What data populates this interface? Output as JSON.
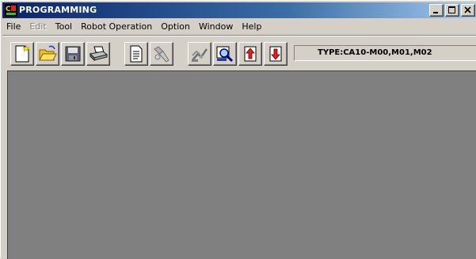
{
  "window": {
    "title": "PROGRAMMING",
    "controls": [
      "minimize",
      "maximize",
      "close"
    ]
  },
  "menu": [
    {
      "label": "File",
      "enabled": true
    },
    {
      "label": "Edit",
      "enabled": false
    },
    {
      "label": "Tool",
      "enabled": true
    },
    {
      "label": "Robot Operation",
      "enabled": true
    },
    {
      "label": "Option",
      "enabled": true
    },
    {
      "label": "Window",
      "enabled": true
    },
    {
      "label": "Help",
      "enabled": true
    }
  ],
  "toolbar": {
    "buttons": [
      "new-file-icon",
      "open-folder-icon",
      "save-icon",
      "print-icon",
      "document-icon",
      "find-icon",
      "robot-icon",
      "search-icon",
      "upload-icon",
      "download-icon"
    ],
    "type_label": "TYPE:CA10-M00,M01,M02"
  },
  "colors": {
    "titlebar_start": "#0a246a",
    "titlebar_end": "#a6caf0",
    "chrome": "#d4d0c8",
    "workspace": "#808080"
  }
}
